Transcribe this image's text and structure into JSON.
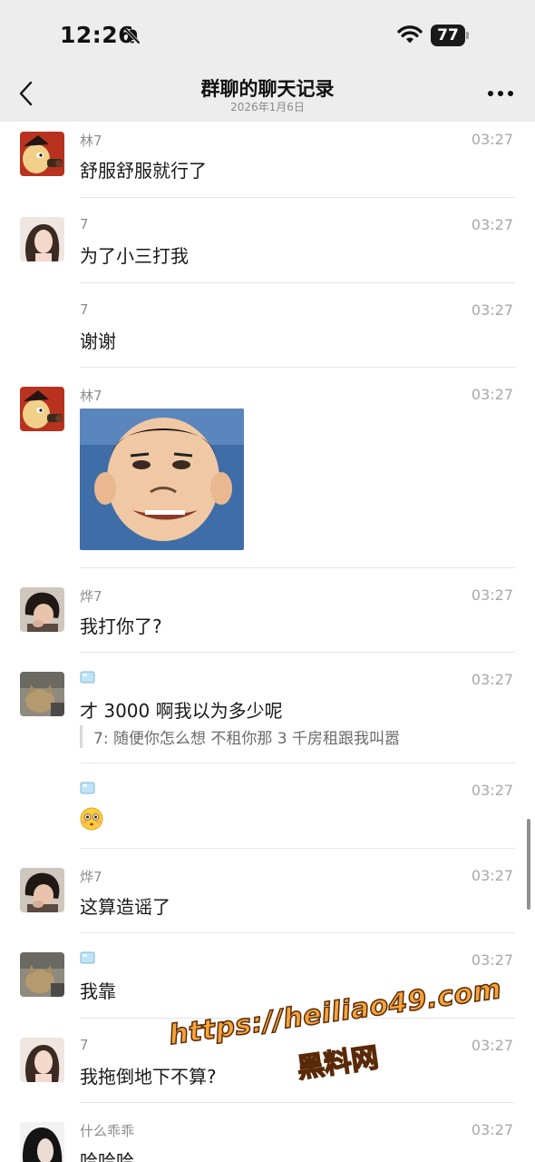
{
  "status_bar": {
    "time": "12:26",
    "battery": "77"
  },
  "header": {
    "title": "群聊的聊天记录",
    "subtitle": "2026年1月6日"
  },
  "messages": [
    {
      "sender": "林7",
      "time": "03:27",
      "text": "舒服舒服就行了",
      "avatar": "cartoon-avatar"
    },
    {
      "sender": "7",
      "time": "03:27",
      "text": "为了小三打我",
      "avatar": "girl-avatar"
    },
    {
      "sender": "7",
      "time": "03:27",
      "text": "谢谢",
      "avatar": ""
    },
    {
      "sender": "林7",
      "time": "03:27",
      "text": "",
      "avatar": "cartoon-avatar",
      "sticker": "cartoon-face-sticker"
    },
    {
      "sender": "烨7",
      "time": "03:27",
      "text": "我打你了?",
      "avatar": "boy-avatar"
    },
    {
      "sender": "🧊",
      "time": "03:27",
      "text": "才 3000 啊我以为多少呢",
      "avatar": "cat-avatar",
      "quote": "7:  随便你怎么想 不租你那 3 千房租跟我叫嚣"
    },
    {
      "sender": "🧊",
      "time": "03:27",
      "text": "",
      "avatar": "",
      "emoji": "flushed-face-emoji"
    },
    {
      "sender": "烨7",
      "time": "03:27",
      "text": "这算造谣了",
      "avatar": "boy-avatar"
    },
    {
      "sender": "🧊",
      "time": "03:27",
      "text": "我靠",
      "avatar": "cat-avatar"
    },
    {
      "sender": "7",
      "time": "03:27",
      "text": "我拖倒地下不算?",
      "avatar": "girl-avatar"
    },
    {
      "sender": "什么乖乖",
      "time": "03:27",
      "text": "哈哈哈",
      "avatar": "dark-hair-avatar"
    }
  ],
  "watermark": {
    "url": "https://heiliao49.com",
    "name": "黑料网"
  }
}
